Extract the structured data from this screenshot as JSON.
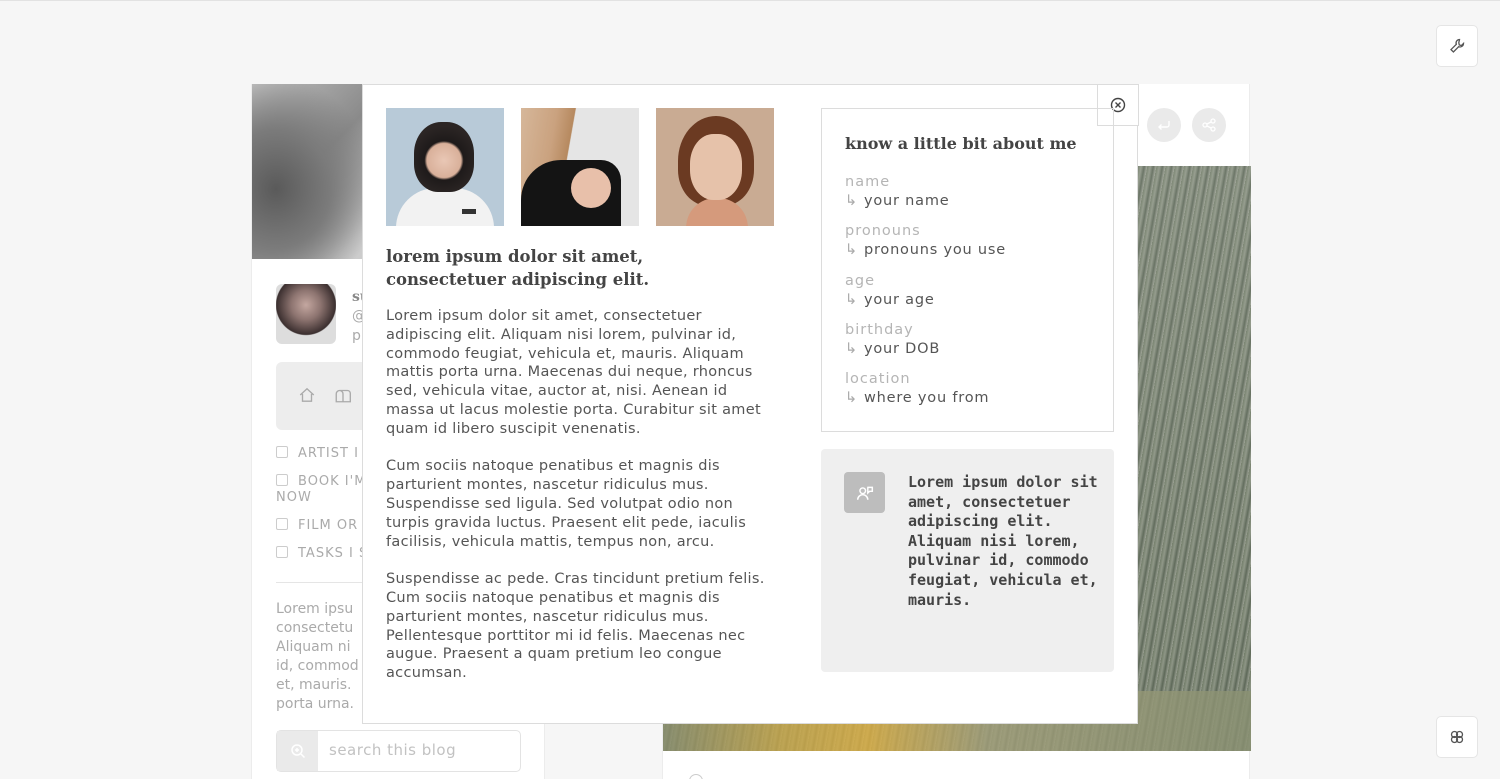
{
  "background_page": {
    "profile": {
      "name_partial": "su",
      "handle_partial": "@",
      "line2_partial": "p"
    },
    "nav_links": [
      {
        "label": "ARTIST I"
      },
      {
        "label": "BOOK I'M",
        "label2": "NOW"
      },
      {
        "label": "FILM OR"
      },
      {
        "label": "TASKS I S"
      }
    ],
    "description_lines": [
      "Lorem ipsu",
      "consectetu",
      "Aliquam ni",
      "id, commod",
      "et, mauris.",
      "porta urna."
    ],
    "search": {
      "placeholder": "search this blog"
    }
  },
  "modal": {
    "heading": "lorem ipsum dolor sit amet, consectetuer adipiscing elit.",
    "paragraphs": [
      "Lorem ipsum dolor sit amet, consectetuer adipiscing elit. Aliquam nisi lorem, pulvinar id, commodo feugiat, vehicula et, mauris. Aliquam mattis porta urna. Maecenas dui neque, rhoncus sed, vehicula vitae, auctor at, nisi. Aenean id massa ut lacus molestie porta. Curabitur sit amet quam id libero suscipit venenatis.",
      "Cum sociis natoque penatibus et magnis dis parturient montes, nascetur ridiculus mus. Suspendisse sed ligula. Sed volutpat odio non turpis gravida luctus. Praesent elit pede, iaculis facilisis, vehicula mattis, tempus non, arcu.",
      "Suspendisse ac pede. Cras tincidunt pretium felis. Cum sociis natoque penatibus et magnis dis parturient montes, nascetur ridiculus mus. Pellentesque porttitor mi id felis. Maecenas nec augue. Praesent a quam pretium leo congue accumsan."
    ],
    "about": {
      "title": "know a little bit about me",
      "arrow": "↳",
      "items": [
        {
          "label": "name",
          "value": "your name"
        },
        {
          "label": "pronouns",
          "value": "pronouns you use"
        },
        {
          "label": "age",
          "value": "your age"
        },
        {
          "label": "birthday",
          "value": "your DOB"
        },
        {
          "label": "location",
          "value": "where you from"
        }
      ]
    },
    "quote": "Lorem ipsum dolor sit amet, consectetuer adipiscing elit. Aliquam nisi lorem, pulvinar id, commodo feugiat, vehicula et, mauris."
  },
  "icons": {
    "settings": "wrench-icon",
    "close": "close-circle-icon",
    "reblog": "reblog-icon",
    "share": "share-icon",
    "theme": "flower-icon",
    "search": "zoom-icon",
    "quote": "user-chat-icon"
  }
}
